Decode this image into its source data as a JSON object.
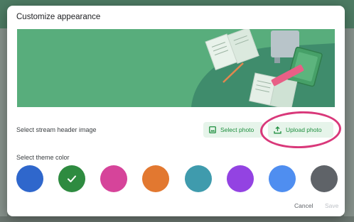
{
  "dialog": {
    "title": "Customize appearance",
    "header_section": {
      "label": "Select stream header image",
      "select_photo": {
        "label": "Select photo",
        "icon": "image-icon"
      },
      "upload_photo": {
        "label": "Upload photo",
        "icon": "upload-icon"
      },
      "highlight_color": "#d9387a"
    },
    "theme_section": {
      "label": "Select theme color",
      "colors": [
        {
          "name": "blue",
          "hex": "#2f67cc",
          "selected": false
        },
        {
          "name": "green",
          "hex": "#2e8b40",
          "selected": true
        },
        {
          "name": "pink",
          "hex": "#d6449a",
          "selected": false
        },
        {
          "name": "orange",
          "hex": "#e27830",
          "selected": false
        },
        {
          "name": "teal",
          "hex": "#3f9bad",
          "selected": false
        },
        {
          "name": "purple",
          "hex": "#9343e2",
          "selected": false
        },
        {
          "name": "light-blue",
          "hex": "#4f8ef0",
          "selected": false
        },
        {
          "name": "gray",
          "hex": "#5f6368",
          "selected": false
        }
      ]
    },
    "footer": {
      "cancel_label": "Cancel",
      "save_label": "Save"
    }
  },
  "accent_color": "#1e8e3e"
}
